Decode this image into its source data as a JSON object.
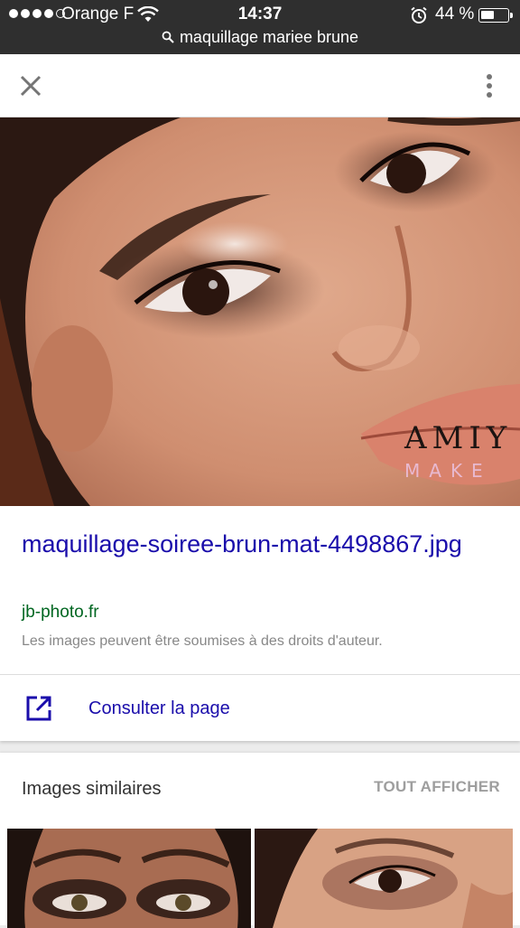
{
  "status_bar": {
    "carrier": "Orange F",
    "time": "14:37",
    "battery": "44 %",
    "battery_level": 0.44,
    "url": "maquillage mariee brune",
    "icons": [
      "signal-dots-icon",
      "wifi-icon",
      "alarm-icon",
      "battery-icon",
      "search-icon"
    ]
  },
  "toolbar": {
    "close_icon": "close-icon",
    "more_icon": "more-vertical-icon"
  },
  "image": {
    "watermark_text": "AMIY",
    "watermark_subtext": "MAKE"
  },
  "result": {
    "title": "maquillage-soiree-brun-mat-4498867.jpg",
    "domain": "jb-photo.fr",
    "copyright_notice": "Les images peuvent être soumises à des droits d'auteur."
  },
  "visit": {
    "label": "Consulter la page",
    "icon": "open-in-new-icon"
  },
  "similar": {
    "title": "Images similaires",
    "see_all": "TOUT AFFICHER"
  },
  "colors": {
    "link": "#1a0dab",
    "domain": "#006621",
    "status_bar_bg": "#2f2f2f"
  }
}
